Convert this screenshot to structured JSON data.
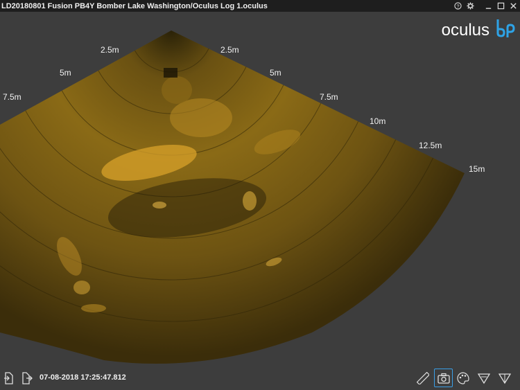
{
  "window": {
    "title": "LD20180801 Fusion PB4Y Bomber Lake Washington/Oculus Log 1.oculus"
  },
  "logo": {
    "text": "oculus"
  },
  "range_labels": {
    "left_2_5": "2.5m",
    "right_2_5": "2.5m",
    "left_5": "5m",
    "right_5": "5m",
    "left_7_5": "7.5m",
    "right_7_5": "7.5m",
    "right_10": "10m",
    "right_12_5": "12.5m",
    "right_15": "15m"
  },
  "status": {
    "timestamp": "07-08-2018 17:25:47.812"
  },
  "colors": {
    "accent": "#3aa0e8",
    "sonar_gold": "#c8901e",
    "background": "#3d3d3d"
  }
}
